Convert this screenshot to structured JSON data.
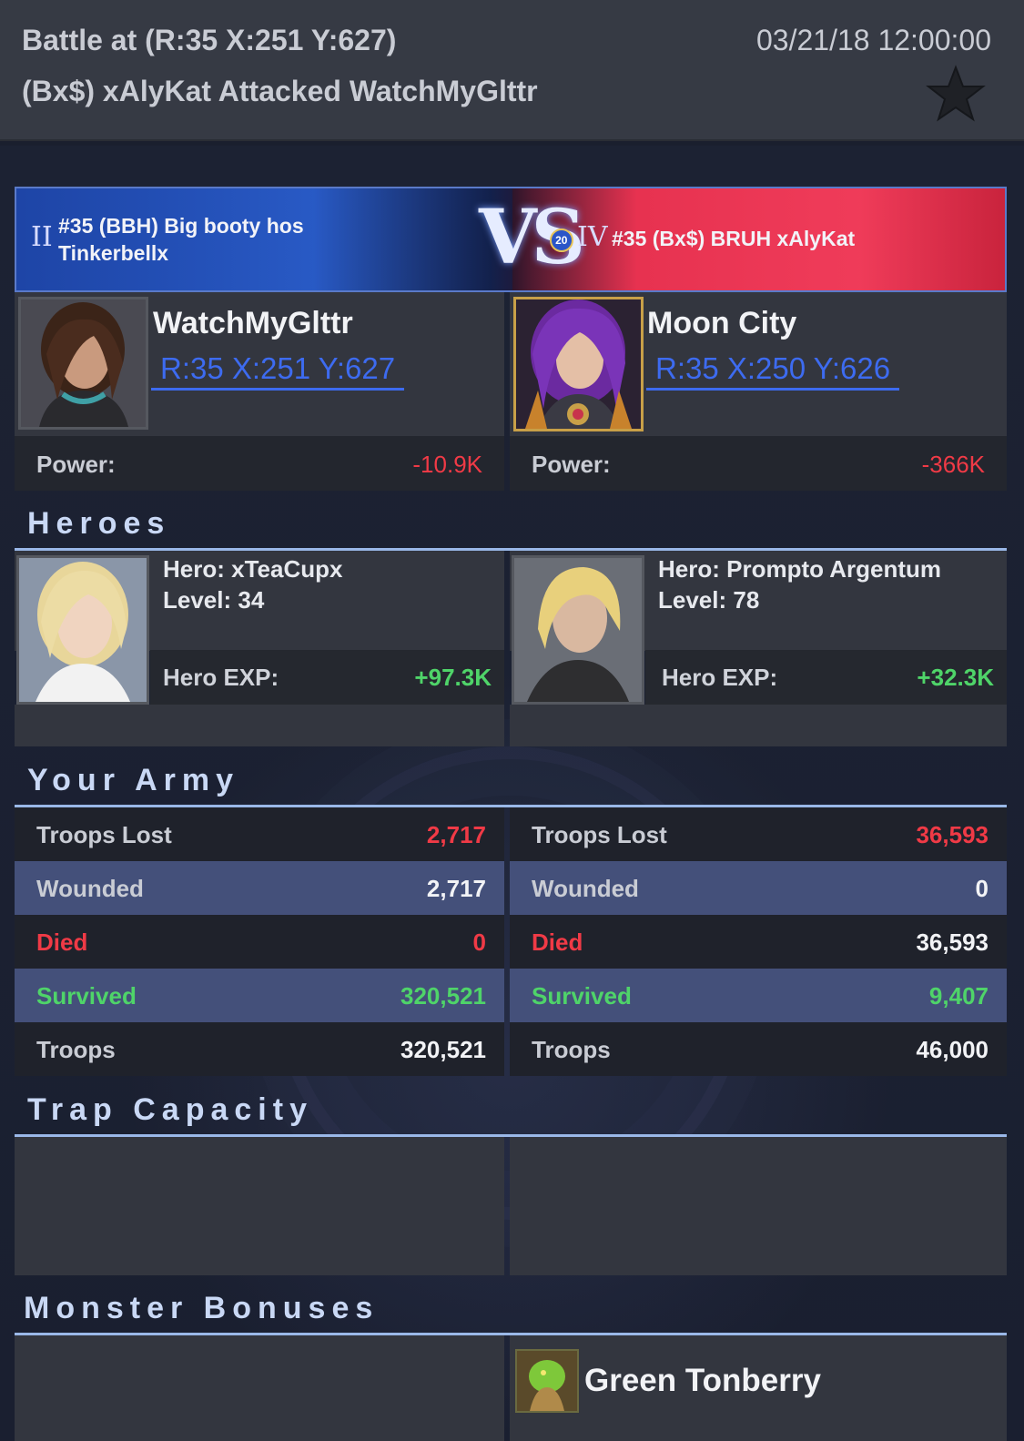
{
  "header": {
    "battle_location": "Battle at (R:35 X:251 Y:627)",
    "battle_summary": "(Bx$) xAlyKat Attacked WatchMyGlttr",
    "timestamp": "03/21/18 12:00:00",
    "favorite_icon": "star-icon"
  },
  "banner": {
    "vs": "VS",
    "left_rank_numeral": "II",
    "left_guild_line1": "#35 (BBH) Big booty hos",
    "left_guild_line2": "Tinkerbellx",
    "right_badge": "20",
    "right_rank_numeral": "IV",
    "right_guild": "#35 (Bx$) BRUH xAlyKat",
    "left_color": "#2a58b8",
    "right_color": "#e8354f"
  },
  "players": {
    "left": {
      "name": "WatchMyGlttr",
      "coords": "R:35 X:251 Y:627",
      "power_label": "Power:",
      "power": "-10.9K"
    },
    "right": {
      "name": "Moon City",
      "coords": "R:35 X:250 Y:626",
      "power_label": "Power:",
      "power": "-366K"
    }
  },
  "heroes": {
    "title": "Heroes",
    "left": {
      "hero": "Hero: xTeaCupx",
      "level": "Level: 34",
      "exp_label": "Hero EXP:",
      "exp": "+97.3K"
    },
    "right": {
      "hero": "Hero: Prompto Argentum",
      "level": "Level: 78",
      "exp_label": "Hero EXP:",
      "exp": "+32.3K"
    }
  },
  "army": {
    "title": "Your Army",
    "left": {
      "troops_lost_label": "Troops Lost",
      "troops_lost": "2,717",
      "wounded_label": "Wounded",
      "wounded": "2,717",
      "died_label": "Died",
      "died": "0",
      "survived_label": "Survived",
      "survived": "320,521",
      "troops_label": "Troops",
      "troops": "320,521"
    },
    "right": {
      "troops_lost_label": "Troops Lost",
      "troops_lost": "36,593",
      "wounded_label": "Wounded",
      "wounded": "0",
      "died_label": "Died",
      "died": "36,593",
      "survived_label": "Survived",
      "survived": "9,407",
      "troops_label": "Troops",
      "troops": "46,000"
    }
  },
  "trap": {
    "title": "Trap Capacity"
  },
  "monster": {
    "title": "Monster Bonuses",
    "right_name": "Green Tonberry"
  },
  "colors": {
    "accent_blue": "#3d6bf0",
    "loss_red": "#f03a46",
    "gain_green": "#4fd469"
  }
}
